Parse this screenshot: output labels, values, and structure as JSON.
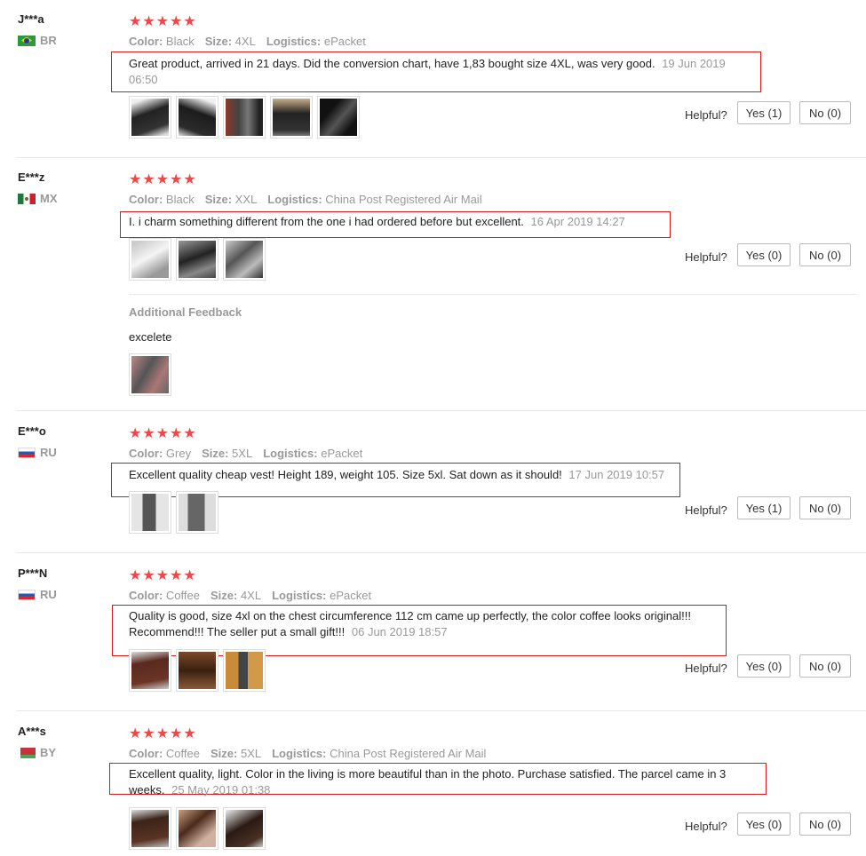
{
  "labels": {
    "color": "Color:",
    "size": "Size:",
    "logistics": "Logistics:",
    "helpful": "Helpful?",
    "additional_feedback": "Additional Feedback",
    "stars": "★★★★★"
  },
  "reviews": [
    {
      "user": "J***a",
      "country": "BR",
      "color": "Black",
      "size": "4XL",
      "logistics": "ePacket",
      "text": "Great product, arrived in 21 days. Did the conversion chart, have 1,83 bought size 4XL, was very good.",
      "date": "19 Jun 2019",
      "time": "06:50",
      "yes": "Yes (1)",
      "no": "No (0)"
    },
    {
      "user": "E***z",
      "country": "MX",
      "color": "Black",
      "size": "XXL",
      "logistics": "China Post Registered Air Mail",
      "text": "I. i charm something different from the one i had ordered before but excellent.",
      "date": "16 Apr 2019 14:27",
      "yes": "Yes (0)",
      "no": "No (0)",
      "additional_text": "excelete"
    },
    {
      "user": "E***o",
      "country": "RU",
      "color": "Grey",
      "size": "5XL",
      "logistics": "ePacket",
      "text": "Excellent quality cheap vest! Height 189, weight 105. Size 5xl. Sat down as it should!",
      "date": "17 Jun 2019 10:57",
      "yes": "Yes (1)",
      "no": "No (0)"
    },
    {
      "user": "P***N",
      "country": "RU",
      "color": "Coffee",
      "size": "4XL",
      "logistics": "ePacket",
      "text_line1": "Quality is good, size 4xl on the chest circumference 112 cm came up perfectly, the color coffee looks original!!!",
      "text_line2": "Recommend!!! The seller put a small gift!!!",
      "date": "06 Jun 2019 18:57",
      "yes": "Yes (0)",
      "no": "No (0)"
    },
    {
      "user": "A***s",
      "country": "BY",
      "color": "Coffee",
      "size": "5XL",
      "logistics": "China Post Registered Air Mail",
      "text_line1": "Excellent quality, light. Color in the living is more beautiful than in the photo. Purchase satisfied. The parcel came in 3",
      "text_line2": "weeks.",
      "date": "25 May 2019 01:38",
      "yes": "Yes (0)",
      "no": "No (0)"
    }
  ],
  "colors": {
    "star": "#f04848",
    "highlight_border": "#d01e1e",
    "muted": "#999999"
  }
}
